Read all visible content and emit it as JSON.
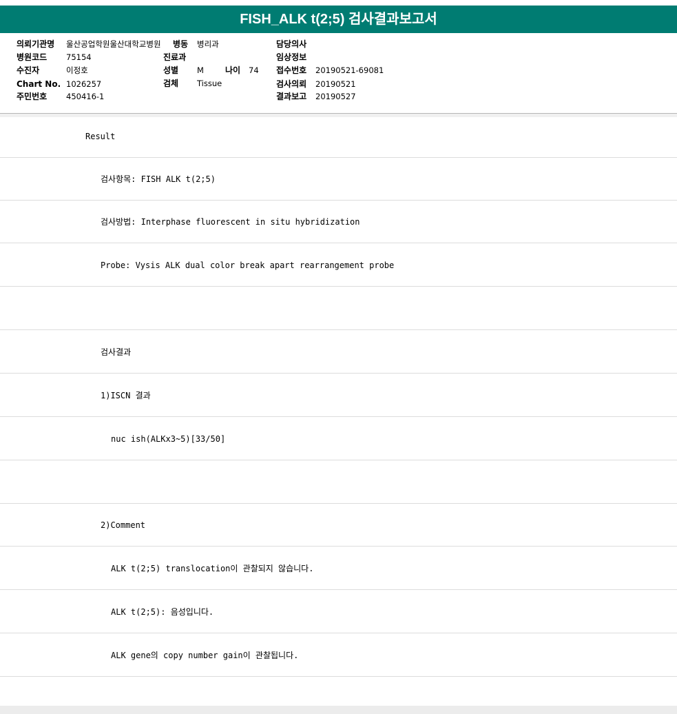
{
  "report": {
    "title": "FISH_ALK t(2;5) 검사결과보고서"
  },
  "info": {
    "institution_label": "의뢰기관명",
    "institution_value": "울산공업학원울산대학교병원",
    "ward_label": "병동",
    "ward_value": "병리과",
    "doctor_label": "담당의사",
    "doctor_value": "",
    "hospital_code_label": "병원코드",
    "hospital_code_value": "75154",
    "department_label": "진료과",
    "department_value": "",
    "clinical_info_label": "임상정보",
    "clinical_info_value": "",
    "patient_label": "수진자",
    "patient_value": "이정호",
    "sex_label": "성별",
    "sex_value": "M",
    "age_label": "나이",
    "age_value": "74",
    "receipt_no_label": "접수번호",
    "receipt_no_value": "20190521-69081",
    "chart_label": "Chart No.",
    "chart_value": "1026257",
    "specimen_label": "검체",
    "specimen_value": "Tissue",
    "request_label": "검사의뢰",
    "request_value": "20190521",
    "id_label": "주민번호",
    "id_value": "450416-1",
    "report_label": "결과보고",
    "report_value": "20190527"
  },
  "result_lines": [
    "Result",
    "검사항목: FISH ALK t(2;5)",
    "검사방법: Interphase fluorescent in situ hybridization",
    "Probe: Vysis ALK dual color break apart rearrangement probe",
    "",
    "검사결과",
    "1)ISCN 결과",
    "nuc ish(ALKx3~5)[33/50]",
    "",
    "2)Comment",
    "ALK t(2;5) translocation이 관찰되지 않습니다.",
    "ALK t(2;5): 음성입니다.",
    "ALK gene의 copy number gain이 관찰됩니다."
  ]
}
